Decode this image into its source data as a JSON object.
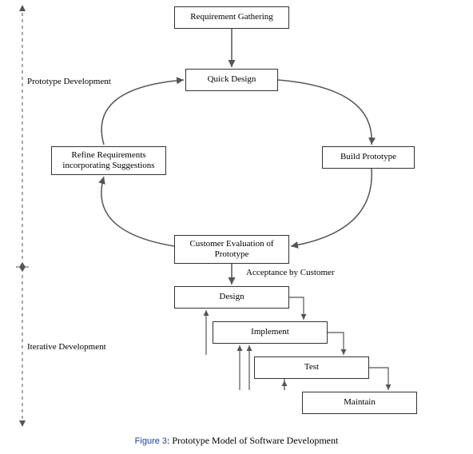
{
  "nodes": {
    "req": "Requirement Gathering",
    "quick": "Quick Design",
    "build": "Build Prototype",
    "eval": "Customer Evaluation of Prototype",
    "refine": "Refine Requirements incorporating Suggestions",
    "design": "Design",
    "implement": "Implement",
    "test": "Test",
    "maintain": "Maintain"
  },
  "labels": {
    "phase1": "Prototype Development",
    "phase2": "Iterative Development",
    "acceptance": "Acceptance by Customer"
  },
  "caption": {
    "prefix": "Figure 3",
    "text": ": Prototype Model of Software Development"
  }
}
